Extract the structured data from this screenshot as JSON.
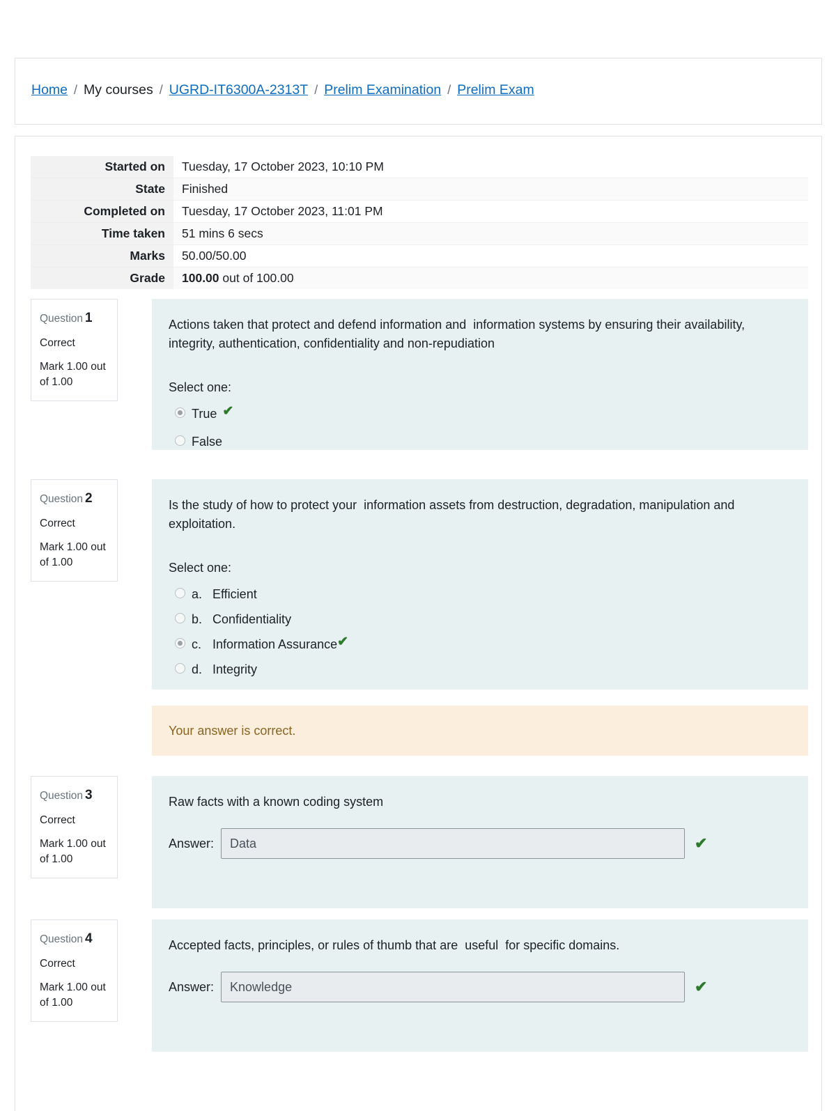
{
  "breadcrumb": {
    "separator": "/",
    "items": [
      {
        "label": "Home",
        "link": true
      },
      {
        "label": "My courses",
        "link": false
      },
      {
        "label": "UGRD-IT6300A-2313T",
        "link": true
      },
      {
        "label": "Prelim Examination",
        "link": true
      },
      {
        "label": "Prelim Exam",
        "link": true
      }
    ]
  },
  "summary": {
    "rows": [
      {
        "label": "Started on",
        "value": "Tuesday, 17 October 2023, 10:10 PM"
      },
      {
        "label": "State",
        "value": "Finished"
      },
      {
        "label": "Completed on",
        "value": "Tuesday, 17 October 2023, 11:01 PM"
      },
      {
        "label": "Time taken",
        "value": "51 mins 6 secs"
      },
      {
        "label": "Marks",
        "value": "50.00/50.00"
      }
    ],
    "grade": {
      "label": "Grade",
      "score": "100.00",
      "suffix": " out of 100.00"
    }
  },
  "questions": [
    {
      "number_label": "Question",
      "number": "1",
      "state": "Correct",
      "mark": "Mark 1.00 out of 1.00",
      "text": "Actions taken that protect and defend information and  information systems by ensuring their availability,  integrity, authentication, confidentiality and non-repudiation",
      "select_one": "Select one:",
      "type": "truefalse",
      "options": [
        {
          "label": "True",
          "selected": true,
          "correct": true
        },
        {
          "label": "False",
          "selected": false,
          "correct": false
        }
      ]
    },
    {
      "number_label": "Question",
      "number": "2",
      "state": "Correct",
      "mark": "Mark 1.00 out of 1.00",
      "text": "Is the study of how to protect your  information assets from destruction, degradation, manipulation and exploitation.",
      "select_one": "Select one:",
      "type": "multichoice",
      "options": [
        {
          "letter": "a.",
          "label": "Efficient",
          "selected": false,
          "correct": false
        },
        {
          "letter": "b.",
          "label": "Confidentiality",
          "selected": false,
          "correct": false
        },
        {
          "letter": "c.",
          "label": "Information Assurance",
          "selected": true,
          "correct": true
        },
        {
          "letter": "d.",
          "label": "Integrity",
          "selected": false,
          "correct": false
        }
      ],
      "feedback": "Your answer is correct."
    },
    {
      "number_label": "Question",
      "number": "3",
      "state": "Correct",
      "mark": "Mark 1.00 out of 1.00",
      "text": "Raw facts with a known coding system",
      "type": "shortanswer",
      "answer_label": "Answer:",
      "answer_value": "Data"
    },
    {
      "number_label": "Question",
      "number": "4",
      "state": "Correct",
      "mark": "Mark 1.00 out of 1.00",
      "text": "Accepted facts, principles, or rules of thumb that are  useful  for specific domains.",
      "type": "shortanswer",
      "answer_label": "Answer:",
      "answer_value": "Knowledge"
    }
  ],
  "icons": {
    "correct_tick": "✔"
  },
  "colors": {
    "link": "#0f6cbf",
    "question_body_bg": "#e7f1f2",
    "feedback_bg": "#fbeedc",
    "feedback_text": "#8a6421",
    "tick_green": "#2d7a2d"
  }
}
